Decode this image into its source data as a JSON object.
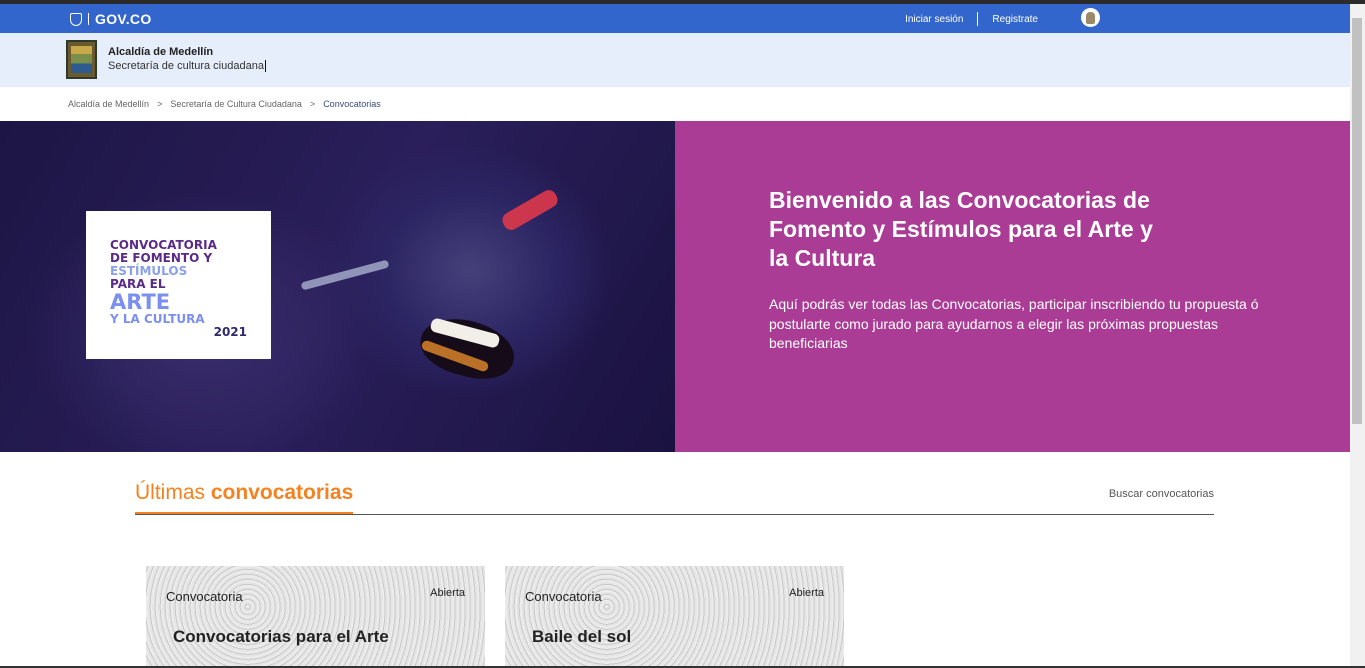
{
  "gov_bar": {
    "logo_text": "GOV.CO",
    "login": "Iniciar sesión",
    "register": "Registrate"
  },
  "entity": {
    "name": "Alcaldía de Medellín",
    "subtitle": "Secretaría de cultura ciudadana"
  },
  "breadcrumb": {
    "items": [
      "Alcaldía de Medellín",
      "Secretaría de Cultura Ciudadana",
      "Convocatorias"
    ],
    "separator": ">"
  },
  "hero": {
    "logo_lines": [
      "CONVOCATORIA",
      "DE FOMENTO Y",
      "ESTÍMULOS",
      "PARA EL",
      "ARTE",
      "Y LA CULTURA",
      "2021"
    ],
    "title": "Bienvenido a las Convocatorias de Fomento y Estímulos para el Arte y la Cultura",
    "description": "Aquí podrás ver todas las Convocatorias, participar inscribiendo tu propuesta ó postularte como jurado para ayudarnos a elegir las próximas propuestas beneficiarias",
    "bg_color": "#ab3c95"
  },
  "latest": {
    "title_prefix": "Últimas",
    "title_bold": "convocatorias",
    "search_link": "Buscar convocatorias",
    "accent": "#f58220",
    "cards": [
      {
        "kind": "Convocatoria",
        "status": "Abierta",
        "name": "Convocatorias para el Arte"
      },
      {
        "kind": "Convocatoria",
        "status": "Abierta",
        "name": "Baile del sol"
      }
    ]
  },
  "colors": {
    "gov_blue": "#3366cc",
    "entity_bg": "#e6eefb"
  }
}
